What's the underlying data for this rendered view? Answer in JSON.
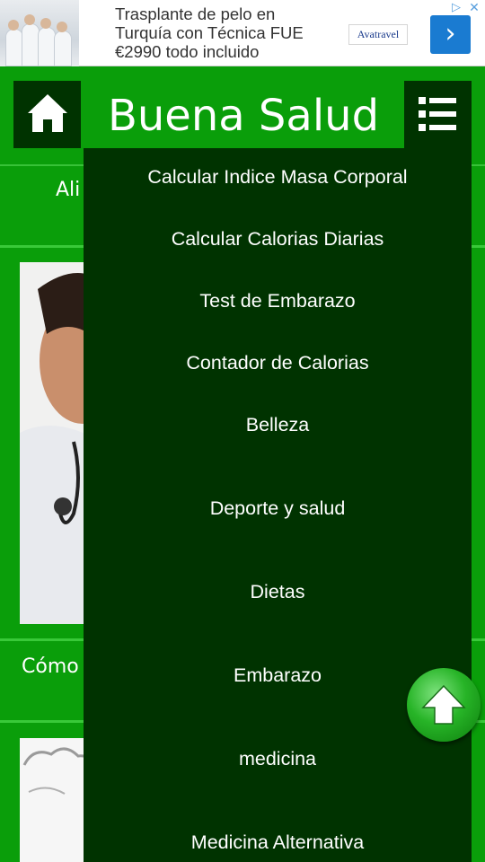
{
  "ad": {
    "line1": "Trasplante de pelo en",
    "line2": "Turquía con Técnica FUE",
    "line3": "€2990 todo incluido",
    "logo_text": "Avatravel",
    "arrow": "›",
    "choices_icon": "▷",
    "close_icon": "✕"
  },
  "header": {
    "title": "Buena Salud"
  },
  "list": {
    "row1_text": "Ali",
    "row2_text": "Cómo"
  },
  "menu": {
    "items": [
      "Calcular Indice Masa Corporal",
      "Calcular Calorias Diarias",
      "Test de Embarazo",
      "Contador de Calorias",
      "Belleza",
      "Deporte y salud",
      "Dietas",
      "Embarazo",
      "medicina",
      "Medicina Alternativa"
    ]
  },
  "colors": {
    "primary_green": "#0a9e0a",
    "dark_green": "#003300",
    "separator": "#39c939"
  },
  "icons": {
    "home": "home-icon",
    "menu": "menu-list-icon",
    "scroll_top": "arrow-up-icon"
  }
}
